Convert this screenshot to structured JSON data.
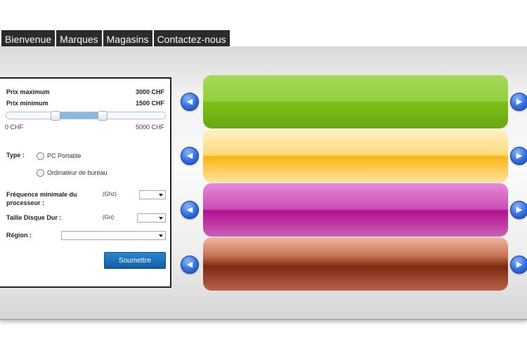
{
  "nav": {
    "items": [
      "Bienvenue",
      "Marques",
      "Magasins",
      "Contactez-nous"
    ]
  },
  "filter": {
    "prix_max_label": "Prix maximum",
    "prix_max_value": "3000 CHF",
    "prix_min_label": "Prix minimum",
    "prix_min_value": "1500 CHF",
    "range_min_label": "0 CHF",
    "range_max_label": "5000 CHF",
    "type_label": "Type :",
    "type_option_1": "PC Portable",
    "type_option_2": "Ordinateur de bureau",
    "freq_label_1": "Fréquence minimale du",
    "freq_label_2": "processeur :",
    "freq_unit": "(Ghz)",
    "disk_label": "Taille Disque Dur :",
    "disk_unit": "(Go)",
    "region_label": "Région :",
    "submit_label": "Soumettre",
    "slider": {
      "min": 0,
      "max": 5000,
      "low": 1500,
      "high": 3000
    }
  },
  "carousel": {
    "arrow_glyph_left": "◀",
    "arrow_glyph_right": "▶",
    "colors": [
      "#7cbd18",
      "#f9b514",
      "#b2138f",
      "#7e2a12"
    ]
  }
}
